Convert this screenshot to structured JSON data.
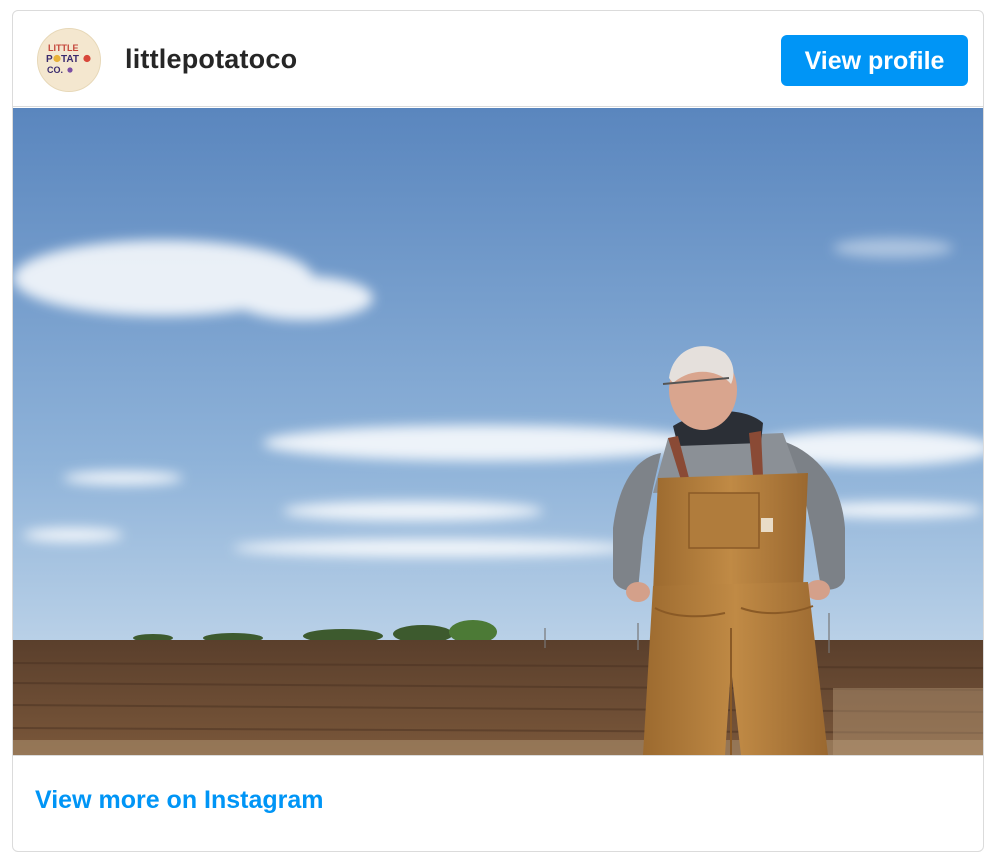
{
  "post": {
    "username": "littlepotatoco",
    "view_profile_label": "View profile",
    "view_more_label": "View more on Instagram",
    "avatar_logo_text": [
      "LITTLE",
      "POTATO",
      "CO."
    ]
  },
  "photo": {
    "subject": "farmer-in-overalls",
    "colors": {
      "sky_top": "#5b87bf",
      "sky_bottom": "#cfe0ef",
      "soil": "#6b4a30",
      "overalls": "#b6803c"
    }
  },
  "colors": {
    "accent": "#0095f6",
    "border": "#dbdbdb",
    "text": "#262626"
  }
}
